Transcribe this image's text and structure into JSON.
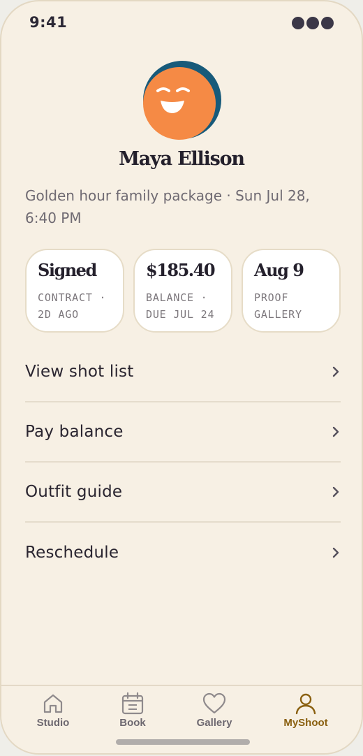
{
  "status_bar": {
    "time": "9:41"
  },
  "profile": {
    "name": "Maya Ellison",
    "subtitle": "Golden hour family package · Sun Jul 28, 6:40 PM",
    "avatar_colors": {
      "face": "#f58a45",
      "ring": "#175a7a"
    }
  },
  "cards": [
    {
      "title": "Signed",
      "caption": "CONTRACT · 2D AGO"
    },
    {
      "title": "$185.40",
      "caption": "BALANCE · DUE JUL 24"
    },
    {
      "title": "Aug 9",
      "caption": "PROOF GALLERY"
    }
  ],
  "menu": [
    {
      "label": "View shot list",
      "icon": "chevron-right-icon"
    },
    {
      "label": "Pay balance",
      "icon": "chevron-right-icon"
    },
    {
      "label": "Outfit guide",
      "icon": "chevron-right-icon"
    },
    {
      "label": "Reschedule",
      "icon": "chevron-right-icon"
    }
  ],
  "tabs": [
    {
      "label": "Studio",
      "icon": "home-icon",
      "active": false
    },
    {
      "label": "Book",
      "icon": "calendar-icon",
      "active": false
    },
    {
      "label": "Gallery",
      "icon": "heart-icon",
      "active": false
    },
    {
      "label": "MyShoot",
      "icon": "user-icon",
      "active": true
    }
  ],
  "colors": {
    "background": "#f7f0e4",
    "card": "#ffffff",
    "accent": "#8a6010",
    "muted_text": "#6f6a72"
  }
}
